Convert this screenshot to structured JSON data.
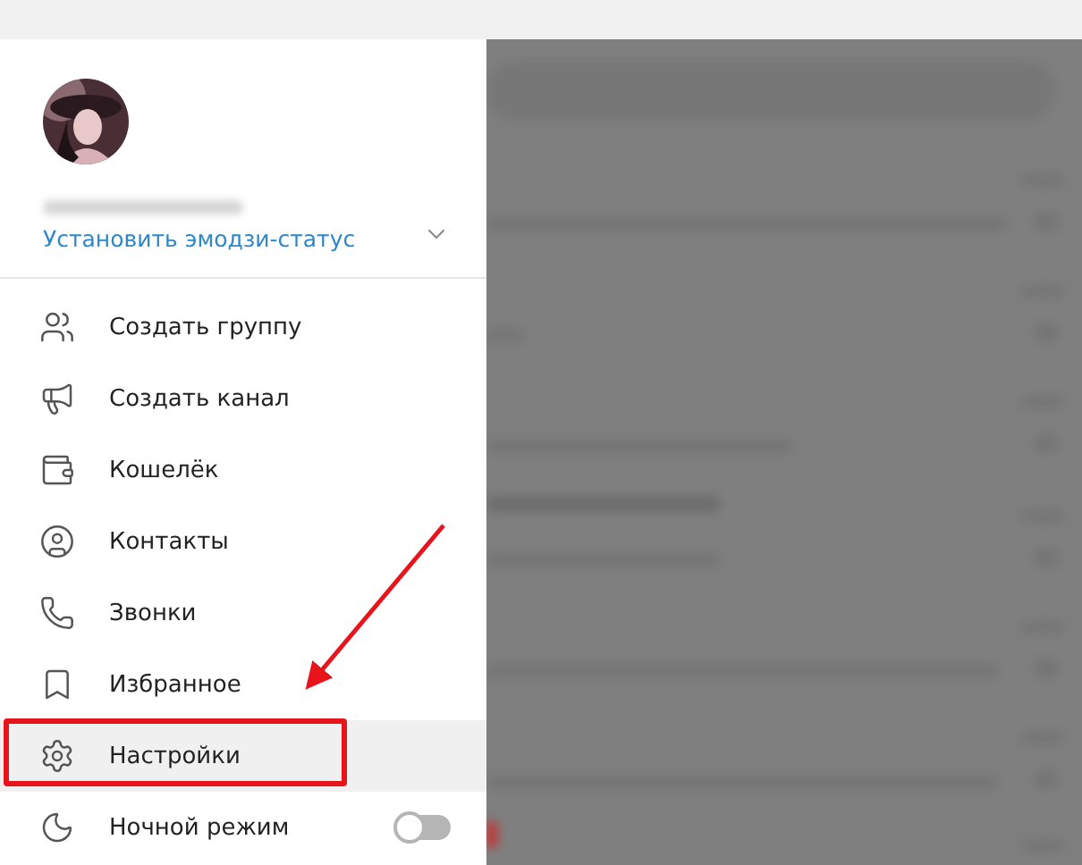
{
  "profile": {
    "status_link": "Установить эмодзи-статус",
    "expanded": false
  },
  "menu": [
    {
      "kind": "item",
      "label": "Создать группу",
      "selected": false,
      "framed": false
    },
    {
      "kind": "item",
      "label": "Создать канал",
      "selected": false,
      "framed": false
    },
    {
      "kind": "item",
      "label": "Кошелёк",
      "selected": false,
      "framed": false
    },
    {
      "kind": "item",
      "label": "Контакты",
      "selected": false,
      "framed": false
    },
    {
      "kind": "item",
      "label": "Звонки",
      "selected": false,
      "framed": false
    },
    {
      "kind": "item",
      "label": "Избранное",
      "selected": false,
      "framed": false
    },
    {
      "kind": "item",
      "label": "Настройки",
      "selected": true,
      "framed": true
    },
    {
      "kind": "toggle",
      "label": "Ночной режим",
      "selected": false,
      "framed": false,
      "on": false
    }
  ]
}
